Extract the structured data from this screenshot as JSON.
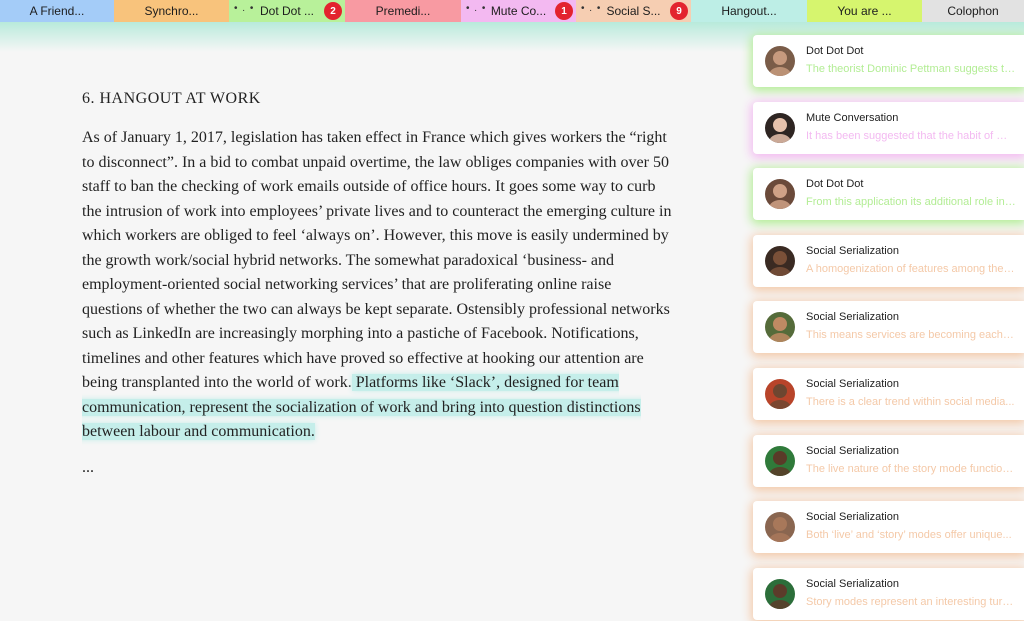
{
  "tabs": [
    {
      "label": "A Friend...",
      "color": "#a4ccf8"
    },
    {
      "label": "Synchro...",
      "color": "#f8c37c"
    },
    {
      "label": "Dot Dot ...",
      "color": "#b8f19a",
      "dots": "• . •",
      "badge": "2"
    },
    {
      "label": "Premedi...",
      "color": "#f89aa2"
    },
    {
      "label": "Mute Co...",
      "color": "#f3b9f1",
      "dots": "• . •",
      "badge": "1"
    },
    {
      "label": "Social S...",
      "color": "#f6ceb2",
      "dots": "• . •",
      "badge": "9"
    },
    {
      "label": "Hangout...",
      "color": "#bdeee6"
    },
    {
      "label": "You are ...",
      "color": "#d6f56e"
    },
    {
      "label": "Colophon",
      "color": "#e2e2e2"
    }
  ],
  "article": {
    "title": "6. HANGOUT AT WORK",
    "body": "As of January 1, 2017, legislation has taken effect in France which gives workers the “right to disconnect”. In a bid to combat unpaid overtime, the law obliges companies with over 50 staff to ban the checking of work emails outside of office hours. It goes some way to curb the intrusion of work into employees’ private lives and to counteract the emerging culture in which workers are obliged to feel ‘always on’. However, this move is easily undermined by the growth work/social hybrid networks. The somewhat paradoxical ‘business- and employment-oriented social networking services’ that are proliferating online raise questions of whether the two can always be kept separate. Ostensibly professional networks such as LinkedIn are increasingly morphing into a pastiche of Facebook. Notifications, timelines and other features which have proved so effective at hooking our attention are being transplanted into the world of work.",
    "highlight": " Platforms like ‘Slack’, designed for team communication, represent the socialization of work and bring into question distinctions between labour and communication.",
    "ellipsis": "..."
  },
  "notifications": [
    {
      "name": "Dot Dot Dot",
      "message": "The theorist Dominic Pettman suggests that the attention economy...",
      "accent": "#b3ed95",
      "avatar_bg": "#7a5c48",
      "avatar_skin": "#c79a7e",
      "avatar": "person-avatar-icon"
    },
    {
      "name": "Mute Conversation",
      "message": "It has been suggested that the habit of muting conversations...",
      "accent": "#f3b9f1",
      "avatar_bg": "#2e2522",
      "avatar_skin": "#e6c1ab",
      "avatar": "person-avatar-icon"
    },
    {
      "name": "Dot Dot Dot",
      "message": "From this application its additional role in the stream...",
      "accent": "#b3ed95",
      "avatar_bg": "#6b4a3a",
      "avatar_skin": "#cfa186",
      "avatar": "person-avatar-icon"
    },
    {
      "name": "Social Serialization",
      "message": "A homogenization of features among the platforms...",
      "accent": "#f4c9a8",
      "avatar_bg": "#3a2a22",
      "avatar_skin": "#7a5038",
      "avatar": "person-avatar-icon"
    },
    {
      "name": "Social Serialization",
      "message": "This means services are becoming each other...",
      "accent": "#f4c9a8",
      "avatar_bg": "#556b3a",
      "avatar_skin": "#c08a63",
      "avatar": "person-avatar-icon"
    },
    {
      "name": "Social Serialization",
      "message": "There is a clear trend within social media...",
      "accent": "#f4c9a8",
      "avatar_bg": "#b8442a",
      "avatar_skin": "#6e4630",
      "avatar": "person-avatar-icon"
    },
    {
      "name": "Social Serialization",
      "message": "The live nature of the story mode function...",
      "accent": "#f4c9a8",
      "avatar_bg": "#2f7a3a",
      "avatar_skin": "#5a3a28",
      "avatar": "person-avatar-icon"
    },
    {
      "name": "Social Serialization",
      "message": "Both ‘live’ and ‘story’ modes offer unique...",
      "accent": "#f4c9a8",
      "avatar_bg": "#8a6650",
      "avatar_skin": "#a8785a",
      "avatar": "person-avatar-icon"
    },
    {
      "name": "Social Serialization",
      "message": "Story modes represent an interesting turn...",
      "accent": "#f4c9a8",
      "avatar_bg": "#2c6e3a",
      "avatar_skin": "#5c3b2a",
      "avatar": "person-avatar-icon"
    }
  ]
}
